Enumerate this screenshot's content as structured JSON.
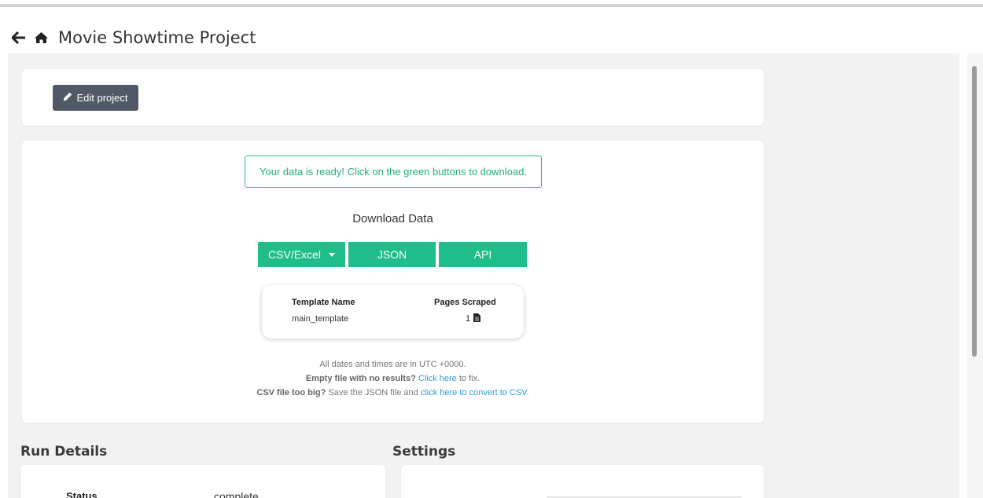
{
  "header": {
    "back_icon": "arrow-left-icon",
    "home_icon": "home-icon",
    "title": "Movie Showtime Project"
  },
  "edit_card": {
    "edit_label": "Edit project",
    "edit_icon": "pencil-icon"
  },
  "download": {
    "alert": "Your data is ready! Click on the green buttons to download.",
    "title": "Download Data",
    "buttons": {
      "csv": "CSV/Excel",
      "json": "JSON",
      "api": "API"
    },
    "templates": {
      "headers": [
        "Template Name",
        "Pages Scraped"
      ],
      "rows": [
        {
          "name": "main_template",
          "pages": "1",
          "pages_icon": "file-icon"
        }
      ]
    },
    "notes": {
      "timezone": "All dates and times are in UTC +0000.",
      "empty_bold": "Empty file with no results?",
      "empty_link": "Click here",
      "empty_tail": "to fix.",
      "big_bold": "CSV file too big?",
      "big_text": "Save the JSON file and",
      "big_link": "click here to convert to CSV."
    }
  },
  "sections": {
    "run_details": "Run Details",
    "settings": "Settings"
  },
  "run_details": {
    "status_label": "Status",
    "status_value": "complete"
  },
  "colors": {
    "accent_green": "#1fbd8a",
    "edit_button": "#525966",
    "link": "#2a9fd6",
    "background": "#f2f2f2"
  }
}
